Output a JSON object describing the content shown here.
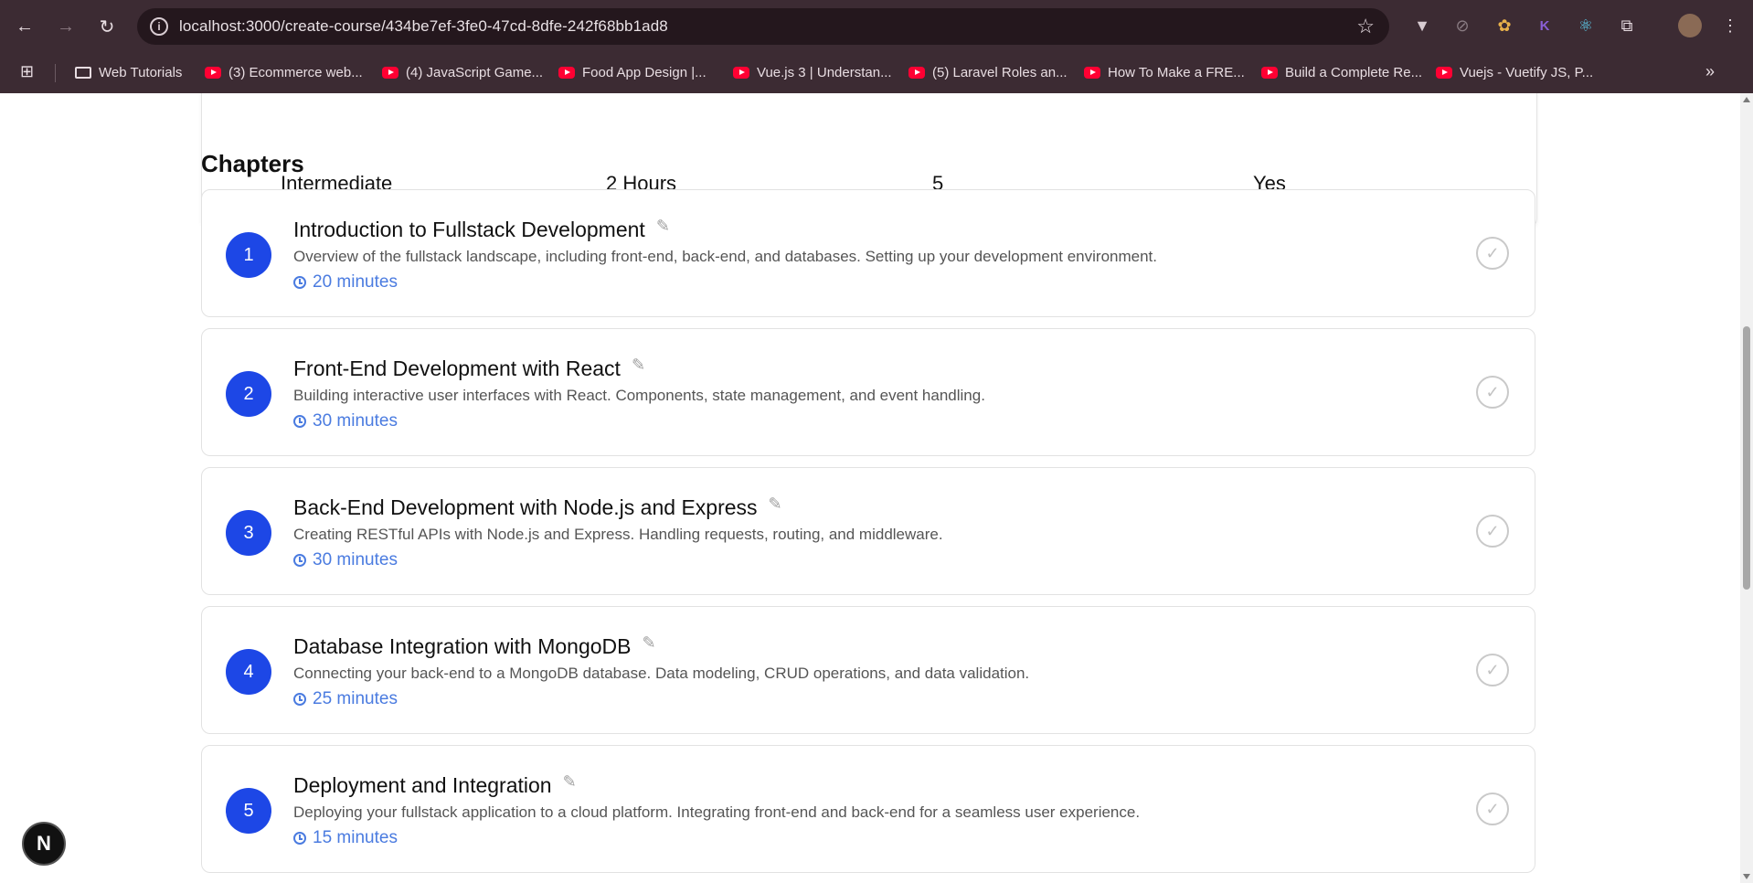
{
  "browser": {
    "url": "localhost:3000/create-course/434be7ef-3fe0-47cd-8dfe-242f68bb1ad8",
    "nav": {
      "back": "←",
      "forward": "→",
      "reload": "↻"
    },
    "bookmarks": [
      {
        "label": "Web Tutorials",
        "icon": "folder-icon"
      },
      {
        "label": "(3) Ecommerce web...",
        "icon": "youtube-icon"
      },
      {
        "label": "(4) JavaScript Game...",
        "icon": "youtube-icon"
      },
      {
        "label": "Food App Design |...",
        "icon": "youtube-icon"
      },
      {
        "label": "Vue.js 3 | Understan...",
        "icon": "youtube-icon"
      },
      {
        "label": "(5) Laravel Roles an...",
        "icon": "youtube-icon"
      },
      {
        "label": "How To Make a FRE...",
        "icon": "youtube-icon"
      },
      {
        "label": "Build a Complete Re...",
        "icon": "youtube-icon"
      },
      {
        "label": "Vuejs - Vuetify JS, P...",
        "icon": "youtube-icon"
      }
    ]
  },
  "stats": [
    "Intermediate",
    "2 Hours",
    "5",
    "Yes"
  ],
  "section_title": "Chapters",
  "chapters": [
    {
      "number": "1",
      "title": "Introduction to Fullstack Development",
      "description": "Overview of the fullstack landscape, including front-end, back-end, and databases. Setting up your development environment.",
      "duration": "20 minutes"
    },
    {
      "number": "2",
      "title": "Front-End Development with React",
      "description": "Building interactive user interfaces with React. Components, state management, and event handling.",
      "duration": "30 minutes"
    },
    {
      "number": "3",
      "title": "Back-End Development with Node.js and Express",
      "description": "Creating RESTful APIs with Node.js and Express. Handling requests, routing, and middleware.",
      "duration": "30 minutes"
    },
    {
      "number": "4",
      "title": "Database Integration with MongoDB",
      "description": "Connecting your back-end to a MongoDB database. Data modeling, CRUD operations, and data validation.",
      "duration": "25 minutes"
    },
    {
      "number": "5",
      "title": "Deployment and Integration",
      "description": "Deploying your fullstack application to a cloud platform. Integrating front-end and back-end for a seamless user experience.",
      "duration": "15 minutes"
    }
  ],
  "dev_badge": "N",
  "colors": {
    "accent": "#1d47e6",
    "duration": "#4a7be0",
    "chrome": "#3c2b33"
  }
}
